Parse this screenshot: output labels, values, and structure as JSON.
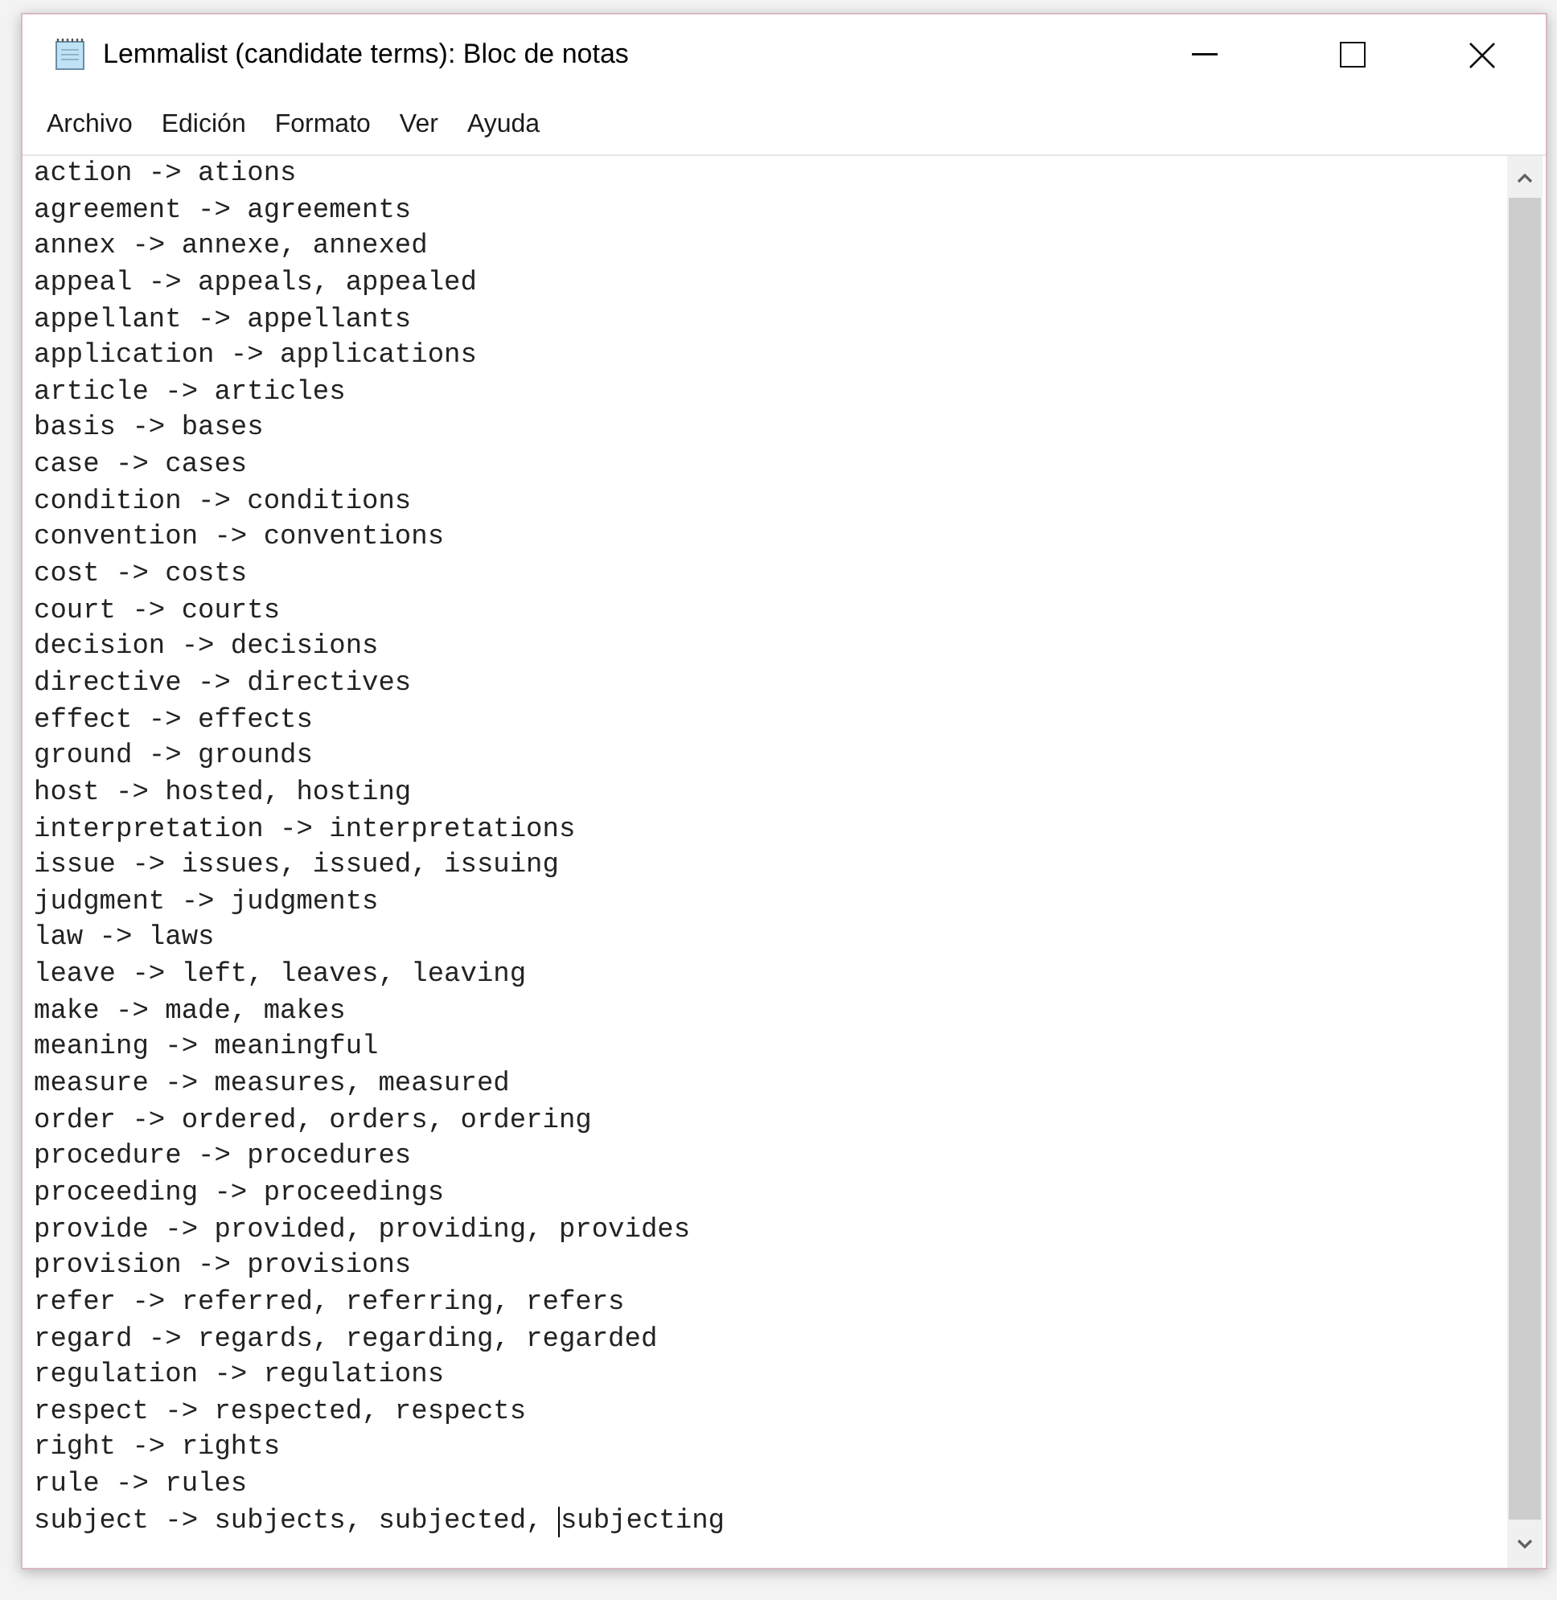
{
  "window": {
    "title": "Lemmalist (candidate terms): Bloc de notas"
  },
  "menu": [
    "Archivo",
    "Edición",
    "Formato",
    "Ver",
    "Ayuda"
  ],
  "lines": [
    {
      "text": "action -> ations"
    },
    {
      "text": "agreement -> agreements"
    },
    {
      "text": "annex -> annexe, annexed"
    },
    {
      "text": "appeal -> appeals, appealed"
    },
    {
      "text": "appellant -> appellants"
    },
    {
      "text": "application -> applications"
    },
    {
      "text": "article -> articles"
    },
    {
      "text": "basis -> bases"
    },
    {
      "text": "case -> cases"
    },
    {
      "text": "condition -> conditions"
    },
    {
      "text": "convention -> conventions"
    },
    {
      "text": "cost -> costs"
    },
    {
      "text": "court -> courts"
    },
    {
      "text": "decision -> decisions"
    },
    {
      "text": "directive -> directives"
    },
    {
      "text": "effect -> effects"
    },
    {
      "text": "ground -> grounds"
    },
    {
      "text": "host -> hosted, hosting"
    },
    {
      "text": "interpretation -> interpretations"
    },
    {
      "text": "issue -> issues, issued, issuing"
    },
    {
      "text": "judgment -> judgments"
    },
    {
      "text": "law -> laws"
    },
    {
      "text": "leave -> left, leaves, leaving"
    },
    {
      "text": "make -> made, makes"
    },
    {
      "text": "meaning -> meaningful"
    },
    {
      "text": "measure -> measures, measured"
    },
    {
      "text": "order -> ordered, orders, ordering"
    },
    {
      "text": "procedure -> procedures"
    },
    {
      "text": "proceeding -> proceedings"
    },
    {
      "text": "provide -> provided, providing, provides"
    },
    {
      "text": "provision -> provisions"
    },
    {
      "text": "refer -> referred, referring, refers"
    },
    {
      "text": "regard -> regards, regarding, regarded"
    },
    {
      "text": "regulation -> regulations"
    },
    {
      "text": "respect -> respected, respects"
    },
    {
      "text": "right -> rights"
    },
    {
      "text": "rule -> rules"
    },
    {
      "text": "subject -> subjects, subjected, ",
      "caret": true,
      "rest": "subjecting"
    }
  ]
}
